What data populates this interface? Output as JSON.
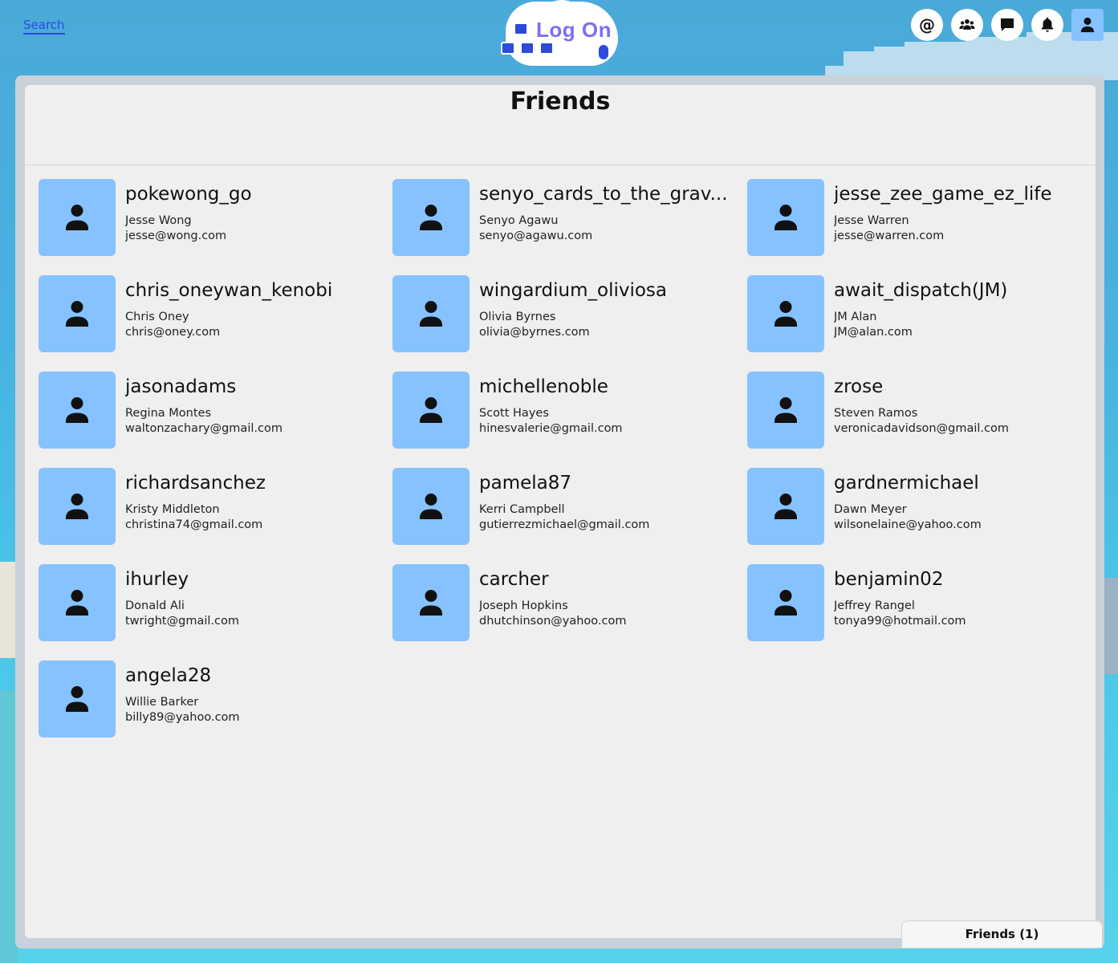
{
  "header": {
    "search_label": "Search",
    "logo_text": "Log On",
    "icons": [
      {
        "name": "at-icon",
        "glyph": "@"
      },
      {
        "name": "group-icon",
        "glyph": ""
      },
      {
        "name": "chat-icon",
        "glyph": ""
      },
      {
        "name": "bell-icon",
        "glyph": ""
      },
      {
        "name": "profile-icon",
        "glyph": ""
      }
    ]
  },
  "page": {
    "title": "Friends"
  },
  "friends": [
    {
      "username": "pokewong_go",
      "name": "Jesse Wong",
      "email": "jesse@wong.com"
    },
    {
      "username": "senyo_cards_to_the_grav...",
      "name": "Senyo Agawu",
      "email": "senyo@agawu.com"
    },
    {
      "username": "jesse_zee_game_ez_life",
      "name": "Jesse Warren",
      "email": "jesse@warren.com"
    },
    {
      "username": "chris_oneywan_kenobi",
      "name": "Chris Oney",
      "email": "chris@oney.com"
    },
    {
      "username": "wingardium_oliviosa",
      "name": "Olivia Byrnes",
      "email": "olivia@byrnes.com"
    },
    {
      "username": "await_dispatch(JM)",
      "name": "JM Alan",
      "email": "JM@alan.com"
    },
    {
      "username": "jasonadams",
      "name": "Regina Montes",
      "email": "waltonzachary@gmail.com"
    },
    {
      "username": "michellenoble",
      "name": "Scott Hayes",
      "email": "hinesvalerie@gmail.com"
    },
    {
      "username": "zrose",
      "name": "Steven Ramos",
      "email": "veronicadavidson@gmail.com"
    },
    {
      "username": "richardsanchez",
      "name": "Kristy Middleton",
      "email": "christina74@gmail.com"
    },
    {
      "username": "pamela87",
      "name": "Kerri Campbell",
      "email": "gutierrezmichael@gmail.com"
    },
    {
      "username": "gardnermichael",
      "name": "Dawn Meyer",
      "email": "wilsonelaine@yahoo.com"
    },
    {
      "username": "ihurley",
      "name": "Donald Ali",
      "email": "twright@gmail.com"
    },
    {
      "username": "carcher",
      "name": "Joseph Hopkins",
      "email": "dhutchinson@yahoo.com"
    },
    {
      "username": "benjamin02",
      "name": "Jeffrey Rangel",
      "email": "tonya99@hotmail.com"
    },
    {
      "username": "angela28",
      "name": "Willie Barker",
      "email": "billy89@yahoo.com"
    }
  ],
  "footer_tab": {
    "label": "Friends (1)"
  },
  "colors": {
    "avatar_bg": "#86c2ff",
    "panel_bg": "#efefef",
    "link": "#2a48e8"
  }
}
